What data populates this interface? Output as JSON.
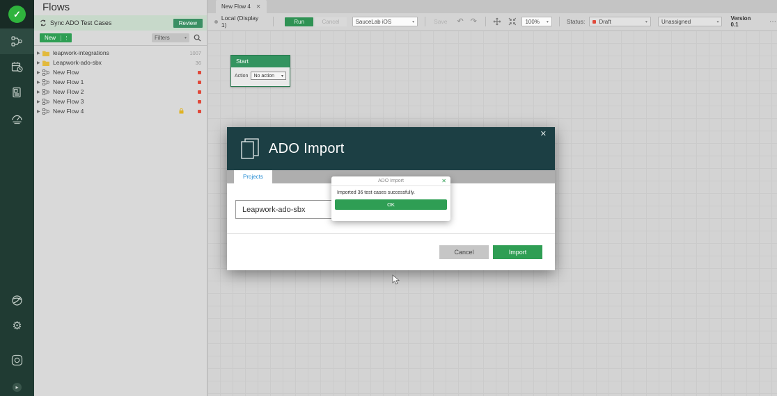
{
  "sidebar": {
    "icons": [
      "leapwork-logo",
      "flows",
      "schedule",
      "reports",
      "dashboard",
      "agents",
      "settings",
      "recorder",
      "expand"
    ]
  },
  "flows_panel": {
    "title": "Flows",
    "sync_banner": {
      "label": "Sync ADO Test Cases",
      "review_button": "Review"
    },
    "new_button": "New",
    "filters_label": "Filters",
    "tree": [
      {
        "label": "leapwork-integrations",
        "type": "folder",
        "badge": "1007"
      },
      {
        "label": "Leapwork-ado-sbx",
        "type": "folder",
        "badge": "36"
      },
      {
        "label": "New Flow",
        "type": "flow"
      },
      {
        "label": "New Flow 1",
        "type": "flow"
      },
      {
        "label": "New Flow 2",
        "type": "flow"
      },
      {
        "label": "New Flow 3",
        "type": "flow"
      },
      {
        "label": "New Flow 4",
        "type": "flow",
        "locked": true
      }
    ]
  },
  "tabbar": {
    "active_tab": "New Flow 4",
    "close": "✕"
  },
  "toolbar": {
    "environment": "Local (Display 1)",
    "run": "Run",
    "cancel": "Cancel",
    "device_select": "SauceLab iOS",
    "save": "Save",
    "undo": "↶",
    "redo": "↷",
    "zoom_level": "100%",
    "status_label": "Status:",
    "status_value": "Draft",
    "assignee": "Unassigned",
    "version": "Version 0.1",
    "more": "⋯"
  },
  "canvas": {
    "start_block": {
      "title": "Start",
      "action_label": "Action",
      "action_value": "No action"
    }
  },
  "modal": {
    "title": "ADO Import",
    "close": "✕",
    "tab": "Projects",
    "project_item": "Leapwork-ado-sbx",
    "cancel_button": "Cancel",
    "import_button": "Import"
  },
  "dialog": {
    "title": "ADO Import",
    "close": "✕",
    "message": "Imported 36 test cases successfully.",
    "ok_button": "OK"
  },
  "colors": {
    "accent_green": "#2f9e54",
    "status_red": "#e0493a",
    "modal_header": "#1c3f44",
    "sidebar_green": "#203b33",
    "folder_yellow": "#e2b93c",
    "tab_blue": "#2a8fd4"
  }
}
